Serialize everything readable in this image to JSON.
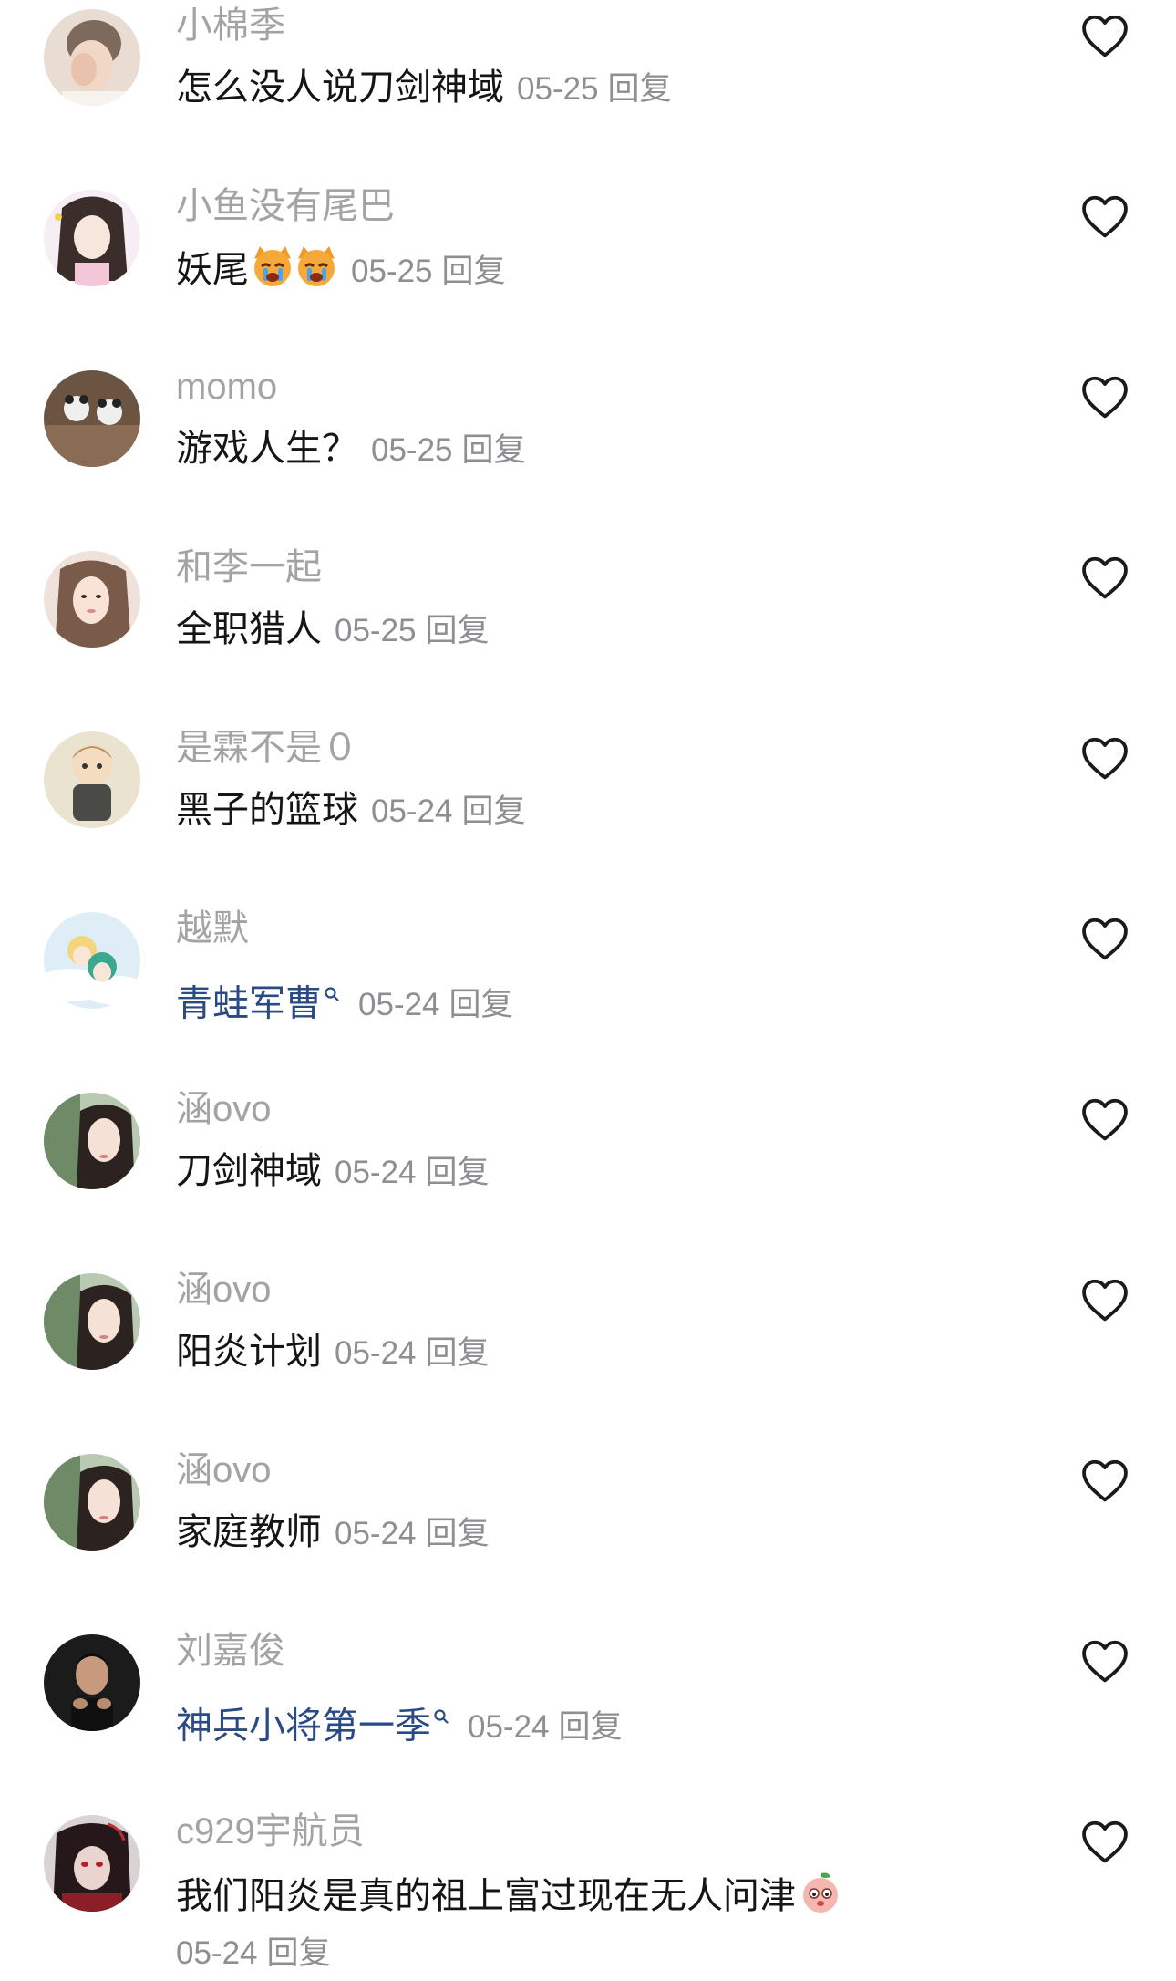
{
  "colors": {
    "username": "#a3a3a6",
    "text": "#151515",
    "link": "#2a4a84",
    "meta": "#8e8e93",
    "heart": "#1a1a1a"
  },
  "icons": {
    "like": "heart-outline-icon",
    "search_hint": "search-icon"
  },
  "comments": [
    {
      "user": "小棉季",
      "text": "怎么没人说刀剑神域",
      "date": "05-25",
      "reply": "回复"
    },
    {
      "user": "小鱼没有尾巴",
      "text": "妖尾",
      "date": "05-25",
      "reply": "回复",
      "emoji": "crying-cat-emoji"
    },
    {
      "user": "momo",
      "text": "游戏人生？",
      "date": "05-25",
      "reply": "回复"
    },
    {
      "user": "和李一起",
      "text": "全职猎人",
      "date": "05-25",
      "reply": "回复"
    },
    {
      "user": "是霖不是０",
      "text": "黑子的篮球",
      "date": "05-24",
      "reply": "回复"
    },
    {
      "user": "越默",
      "text": "青蛙军曹",
      "date": "05-24",
      "reply": "回复",
      "linked": true
    },
    {
      "user": "涵ovo",
      "text": "刀剑神域",
      "date": "05-24",
      "reply": "回复"
    },
    {
      "user": "涵ovo",
      "text": "阳炎计划",
      "date": "05-24",
      "reply": "回复"
    },
    {
      "user": "涵ovo",
      "text": "家庭教师",
      "date": "05-24",
      "reply": "回复"
    },
    {
      "user": "刘嘉俊",
      "text": "神兵小将第一季",
      "date": "05-24",
      "reply": "回复",
      "linked": true
    },
    {
      "user": "c929宇航员",
      "text": "我们阳炎是真的祖上富过现在无人问津",
      "date": "05-24",
      "reply": "回复",
      "emoji": "peach-face-emoji"
    }
  ]
}
